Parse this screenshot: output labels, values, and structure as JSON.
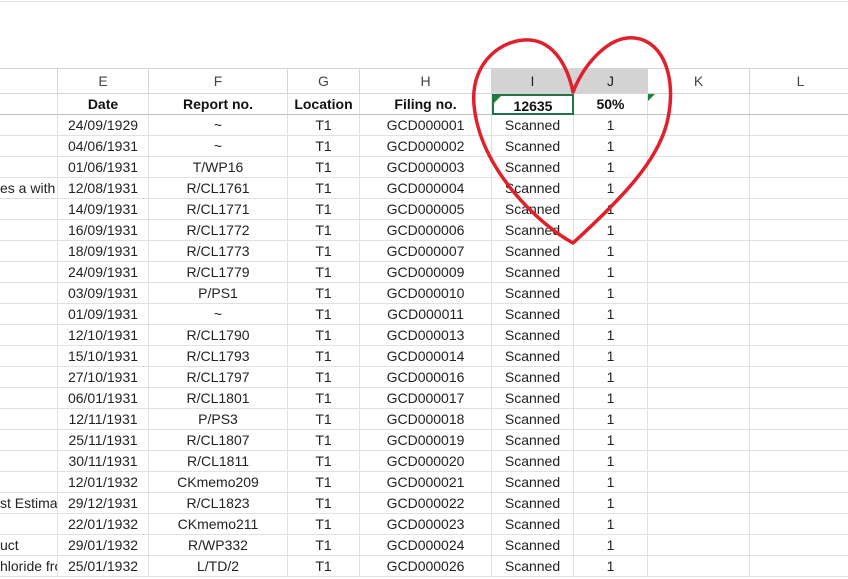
{
  "column_letters": [
    "E",
    "F",
    "G",
    "H",
    "I",
    "J",
    "K",
    "L"
  ],
  "headers": {
    "date": "Date",
    "report_no": "Report no.",
    "location": "Location",
    "filing_no": "Filing no.",
    "count": "12635",
    "percent": "50%"
  },
  "rows": [
    {
      "d": "",
      "date": "24/09/1929",
      "report": "~",
      "loc": "T1",
      "filing": "GCD000001",
      "status": "Scanned",
      "flag": "1"
    },
    {
      "d": "",
      "date": "04/06/1931",
      "report": "~",
      "loc": "T1",
      "filing": "GCD000002",
      "status": "Scanned",
      "flag": "1"
    },
    {
      "d": "",
      "date": "01/06/1931",
      "report": "T/WP16",
      "loc": "T1",
      "filing": "GCD000003",
      "status": "Scanned",
      "flag": "1"
    },
    {
      "d": "es a with",
      "date": "12/08/1931",
      "report": "R/CL1761",
      "loc": "T1",
      "filing": "GCD000004",
      "status": "Scanned",
      "flag": "1"
    },
    {
      "d": "",
      "date": "14/09/1931",
      "report": "R/CL1771",
      "loc": "T1",
      "filing": "GCD000005",
      "status": "Scanned",
      "flag": "1"
    },
    {
      "d": "",
      "date": "16/09/1931",
      "report": "R/CL1772",
      "loc": "T1",
      "filing": "GCD000006",
      "status": "Scanned",
      "flag": "1"
    },
    {
      "d": "",
      "date": "18/09/1931",
      "report": "R/CL1773",
      "loc": "T1",
      "filing": "GCD000007",
      "status": "Scanned",
      "flag": "1"
    },
    {
      "d": "",
      "date": "24/09/1931",
      "report": "R/CL1779",
      "loc": "T1",
      "filing": "GCD000009",
      "status": "Scanned",
      "flag": "1"
    },
    {
      "d": "",
      "date": "03/09/1931",
      "report": "P/PS1",
      "loc": "T1",
      "filing": "GCD000010",
      "status": "Scanned",
      "flag": "1"
    },
    {
      "d": "",
      "date": "01/09/1931",
      "report": "~",
      "loc": "T1",
      "filing": "GCD000011",
      "status": "Scanned",
      "flag": "1"
    },
    {
      "d": "",
      "date": "12/10/1931",
      "report": "R/CL1790",
      "loc": "T1",
      "filing": "GCD000013",
      "status": "Scanned",
      "flag": "1"
    },
    {
      "d": "",
      "date": "15/10/1931",
      "report": "R/CL1793",
      "loc": "T1",
      "filing": "GCD000014",
      "status": "Scanned",
      "flag": "1"
    },
    {
      "d": "",
      "date": "27/10/1931",
      "report": "R/CL1797",
      "loc": "T1",
      "filing": "GCD000016",
      "status": "Scanned",
      "flag": "1"
    },
    {
      "d": "",
      "date": "06/01/1931",
      "report": "R/CL1801",
      "loc": "T1",
      "filing": "GCD000017",
      "status": "Scanned",
      "flag": "1"
    },
    {
      "d": "",
      "date": "12/11/1931",
      "report": "P/PS3",
      "loc": "T1",
      "filing": "GCD000018",
      "status": "Scanned",
      "flag": "1"
    },
    {
      "d": "",
      "date": "25/11/1931",
      "report": "R/CL1807",
      "loc": "T1",
      "filing": "GCD000019",
      "status": "Scanned",
      "flag": "1"
    },
    {
      "d": "",
      "date": "30/11/1931",
      "report": "R/CL1811",
      "loc": "T1",
      "filing": "GCD000020",
      "status": "Scanned",
      "flag": "1"
    },
    {
      "d": "",
      "date": "12/01/1932",
      "report": "CKmemo209",
      "loc": "T1",
      "filing": "GCD000021",
      "status": "Scanned",
      "flag": "1"
    },
    {
      "d": "st Estima",
      "date": "29/12/1931",
      "report": "R/CL1823",
      "loc": "T1",
      "filing": "GCD000022",
      "status": "Scanned",
      "flag": "1"
    },
    {
      "d": "",
      "date": "22/01/1932",
      "report": "CKmemo211",
      "loc": "T1",
      "filing": "GCD000023",
      "status": "Scanned",
      "flag": "1"
    },
    {
      "d": "uct",
      "date": "29/01/1932",
      "report": "R/WP332",
      "loc": "T1",
      "filing": "GCD000024",
      "status": "Scanned",
      "flag": "1"
    },
    {
      "d": "hloride fro",
      "date": "25/01/1932",
      "report": "L/TD/2",
      "loc": "T1",
      "filing": "GCD000026",
      "status": "Scanned",
      "flag": "1"
    }
  ],
  "colors": {
    "heart": "#e0202a",
    "selection": "#217346",
    "comment_marker": "#1e7e34",
    "selected_header": "#d3d3d3"
  }
}
